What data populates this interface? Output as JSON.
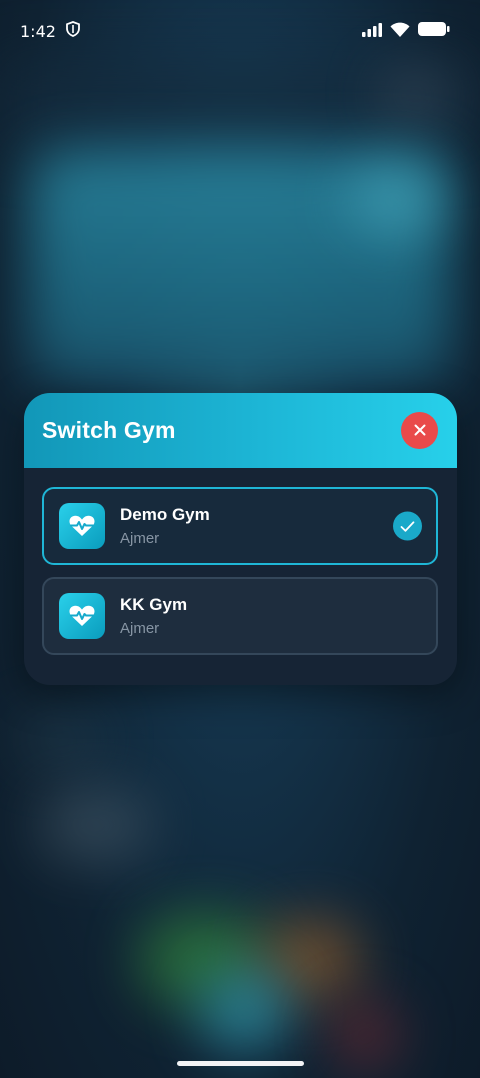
{
  "status_bar": {
    "time": "1:42"
  },
  "modal": {
    "title": "Switch Gym",
    "gyms": [
      {
        "name": "Demo Gym",
        "city": "Ajmer",
        "selected": true
      },
      {
        "name": "KK Gym",
        "city": "Ajmer",
        "selected": false
      }
    ]
  },
  "colors": {
    "accent": "#1db6d6",
    "close": "#e94a4a",
    "panel": "#162435"
  }
}
